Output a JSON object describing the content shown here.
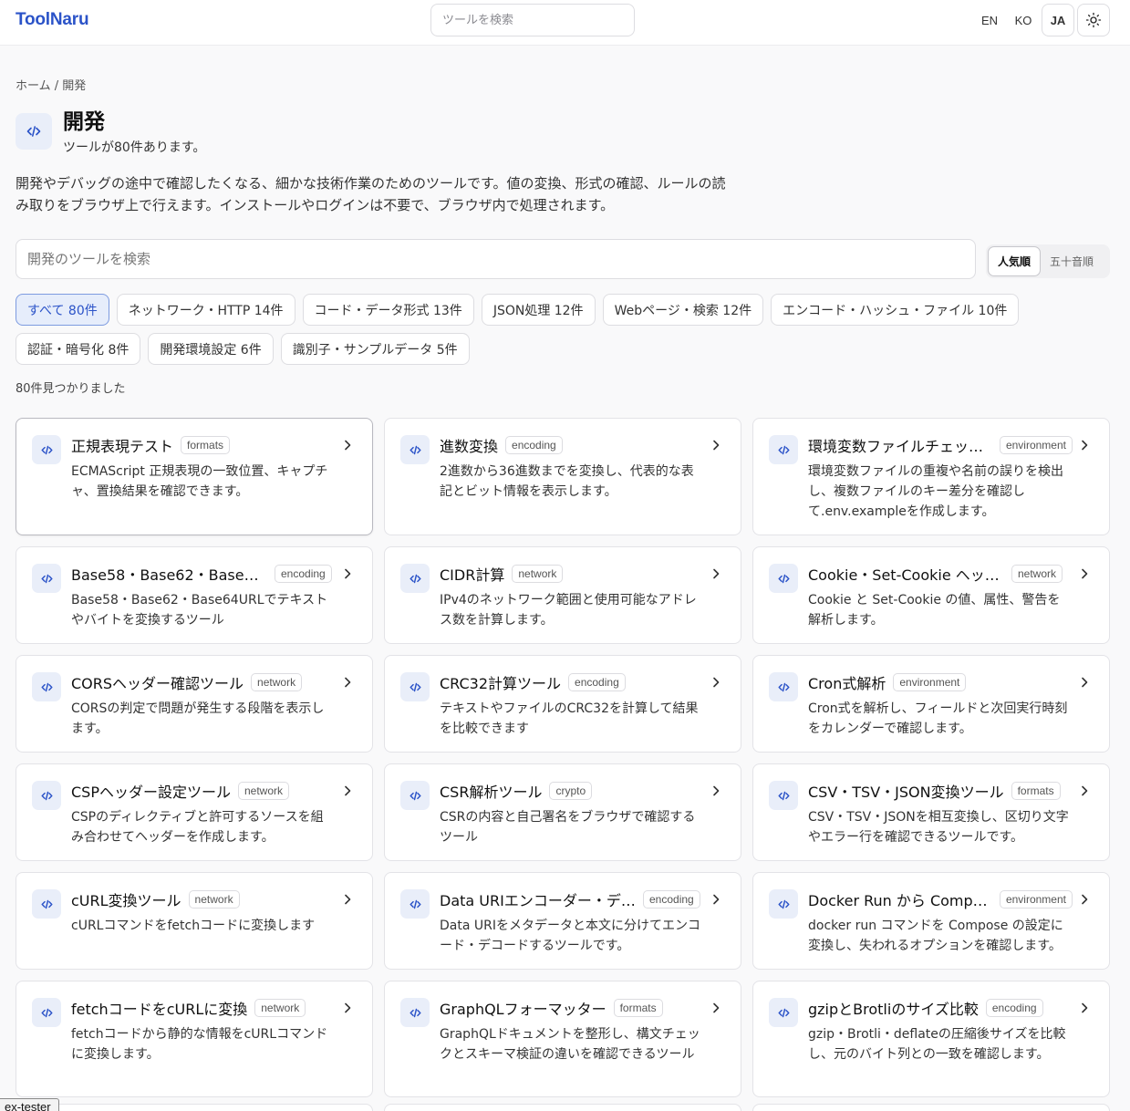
{
  "header": {
    "logo": "ToolNaru",
    "search_placeholder": "ツールを検索",
    "languages": [
      "EN",
      "KO",
      "JA"
    ],
    "active_language": "JA",
    "theme_icon": "sun-icon"
  },
  "breadcrumb": {
    "home": "ホーム",
    "separator": "/",
    "current": "開発"
  },
  "category": {
    "icon": "code-icon",
    "title": "開発",
    "count_text": "ツールが80件あります。",
    "description": "開発やデバッグの途中で確認したくなる、細かな技術作業のためのツールです。値の変換、形式の確認、ルールの読み取りをブラウザ上で行えます。インストールやログインは不要で、ブラウザ内で処理されます。"
  },
  "search": {
    "placeholder": "開発のツールを検索"
  },
  "sort": {
    "options": [
      "人気順",
      "五十音順"
    ],
    "active": "人気順"
  },
  "filters": [
    {
      "label": "すべて 80件",
      "active": true
    },
    {
      "label": "ネットワーク・HTTP 14件",
      "active": false
    },
    {
      "label": "コード・データ形式 13件",
      "active": false
    },
    {
      "label": "JSON処理 12件",
      "active": false
    },
    {
      "label": "Webページ・検索 12件",
      "active": false
    },
    {
      "label": "エンコード・ハッシュ・ファイル 10件",
      "active": false
    },
    {
      "label": "認証・暗号化 8件",
      "active": false
    },
    {
      "label": "開発環境設定 6件",
      "active": false
    },
    {
      "label": "識別子・サンプルデータ 5件",
      "active": false
    }
  ],
  "results_text": "80件見つかりました",
  "tools": [
    {
      "title": "正規表現テスト",
      "tag": "formats",
      "desc": "ECMAScript 正規表現の一致位置、キャプチャ、置換結果を確認できます。"
    },
    {
      "title": "進数変換",
      "tag": "encoding",
      "desc": "2進数から36進数までを変換し、代表的な表記とビット情報を表示します。"
    },
    {
      "title": "環境変数ファイルチェッカ...",
      "tag": "environment",
      "desc": "環境変数ファイルの重複や名前の誤りを検出し、複数ファイルのキー差分を確認して.env.exampleを作成します。"
    },
    {
      "title": "Base58・Base62・Base64...",
      "tag": "encoding",
      "desc": "Base58・Base62・Base64URLでテキストやバイトを変換するツール"
    },
    {
      "title": "CIDR計算",
      "tag": "network",
      "desc": "IPv4のネットワーク範囲と使用可能なアドレス数を計算します。"
    },
    {
      "title": "Cookie・Set-Cookie ヘッダ...",
      "tag": "network",
      "desc": "Cookie と Set-Cookie の値、属性、警告を解析します。"
    },
    {
      "title": "CORSヘッダー確認ツール",
      "tag": "network",
      "desc": "CORSの判定で問題が発生する段階を表示します。"
    },
    {
      "title": "CRC32計算ツール",
      "tag": "encoding",
      "desc": "テキストやファイルのCRC32を計算して結果を比較できます"
    },
    {
      "title": "Cron式解析",
      "tag": "environment",
      "desc": "Cron式を解析し、フィールドと次回実行時刻をカレンダーで確認します。"
    },
    {
      "title": "CSPヘッダー設定ツール",
      "tag": "network",
      "desc": "CSPのディレクティブと許可するソースを組み合わせてヘッダーを作成します。"
    },
    {
      "title": "CSR解析ツール",
      "tag": "crypto",
      "desc": "CSRの内容と自己署名をブラウザで確認するツール"
    },
    {
      "title": "CSV・TSV・JSON変換ツール",
      "tag": "formats",
      "desc": "CSV・TSV・JSONを相互変換し、区切り文字やエラー行を確認できるツールです。"
    },
    {
      "title": "cURL変換ツール",
      "tag": "network",
      "desc": "cURLコマンドをfetchコードに変換します"
    },
    {
      "title": "Data URIエンコーダー・デコ...",
      "tag": "encoding",
      "desc": "Data URIをメタデータと本文に分けてエンコード・デコードするツールです。"
    },
    {
      "title": "Docker Run から Compos...",
      "tag": "environment",
      "desc": "docker run コマンドを Compose の設定に変換し、失われるオプションを確認します。"
    },
    {
      "title": "fetchコードをcURLに変換",
      "tag": "network",
      "desc": "fetchコードから静的な情報をcURLコマンドに変換します。"
    },
    {
      "title": "GraphQLフォーマッター",
      "tag": "formats",
      "desc": "GraphQLドキュメントを整形し、構文チェックとスキーマ検証の違いを確認できるツール"
    },
    {
      "title": "gzipとBrotliのサイズ比較",
      "tag": "encoding",
      "desc": "gzip・Brotli・deflateの圧縮後サイズを比較し、元のバイト列との一致を確認します。"
    }
  ],
  "tooltip_text": "ex-tester"
}
